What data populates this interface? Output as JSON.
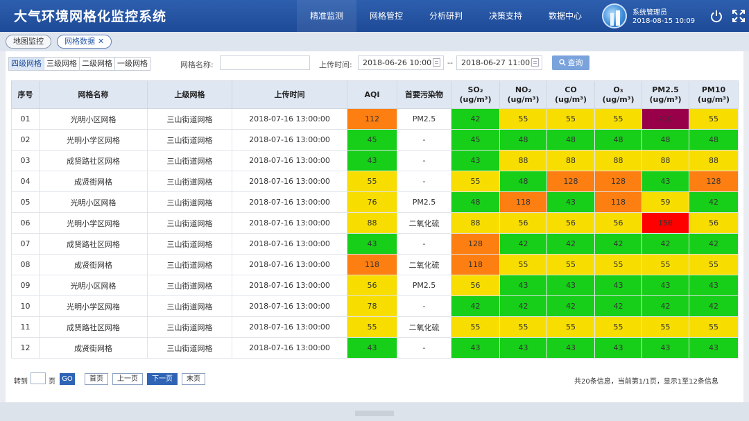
{
  "header": {
    "title": "大气环境网格化监控系统",
    "nav": [
      "精准监测",
      "网格管控",
      "分析研判",
      "决策支持",
      "数据中心"
    ],
    "user_name": "系统管理员",
    "user_time": "2018-08-15 10:09"
  },
  "tabs": [
    {
      "label": "地图监控"
    },
    {
      "label": "网格数据",
      "close": "✕"
    }
  ],
  "filters": {
    "levels": [
      "四级网格",
      "三级网格",
      "二级网格",
      "一级网格"
    ],
    "grid_name_label": "网格名称:",
    "grid_name_value": "",
    "upload_time_label": "上传时间:",
    "start_time": "2018-06-26 10:00",
    "separator": "--",
    "end_time": "2018-06-27 11:00",
    "query_label": "查询"
  },
  "table": {
    "headers": {
      "index": "序号",
      "name": "网格名称",
      "parent": "上级网格",
      "time": "上传时间",
      "aqi": "AQI",
      "primary": "首要污染物",
      "so2": "SO₂",
      "no2": "NO₂",
      "co": "CO",
      "o3": "O₃",
      "pm25": "PM2.5",
      "pm10": "PM10",
      "unit": "(ug/m³)"
    },
    "rows": [
      {
        "idx": "01",
        "name": "光明小区网格",
        "parent": "三山街道网格",
        "time": "2018-07-16 13:00:00",
        "aqi": 112,
        "primary": "PM2.5",
        "so2": 42,
        "no2": 55,
        "co": 55,
        "o3": 55,
        "pm25": 210,
        "pm10": 55
      },
      {
        "idx": "02",
        "name": "光明小学区网格",
        "parent": "三山街道网格",
        "time": "2018-07-16 13:00:00",
        "aqi": 45,
        "primary": "-",
        "so2": 45,
        "no2": 48,
        "co": 48,
        "o3": 48,
        "pm25": 48,
        "pm10": 48
      },
      {
        "idx": "03",
        "name": "成贤路社区网格",
        "parent": "三山街道网格",
        "time": "2018-07-16 13:00:00",
        "aqi": 43,
        "primary": "-",
        "so2": 43,
        "no2": 88,
        "co": 88,
        "o3": 88,
        "pm25": 88,
        "pm10": 88
      },
      {
        "idx": "04",
        "name": "成贤街网格",
        "parent": "三山街道网格",
        "time": "2018-07-16 13:00:00",
        "aqi": 55,
        "primary": "-",
        "so2": 55,
        "no2": 48,
        "co": 128,
        "o3": 128,
        "pm25": 43,
        "pm10": 128
      },
      {
        "idx": "05",
        "name": "光明小区网格",
        "parent": "三山街道网格",
        "time": "2018-07-16 13:00:00",
        "aqi": 76,
        "primary": "PM2.5",
        "so2": 48,
        "no2": 118,
        "co": 43,
        "o3": 118,
        "pm25": 59,
        "pm10": 42
      },
      {
        "idx": "06",
        "name": "光明小学区网格",
        "parent": "三山街道网格",
        "time": "2018-07-16 13:00:00",
        "aqi": 88,
        "primary": "二氧化硫",
        "so2": 88,
        "no2": 56,
        "co": 56,
        "o3": 56,
        "pm25": 156,
        "pm10": 56
      },
      {
        "idx": "07",
        "name": "成贤路社区网格",
        "parent": "三山街道网格",
        "time": "2018-07-16 13:00:00",
        "aqi": 43,
        "primary": "-",
        "so2": 128,
        "no2": 42,
        "co": 42,
        "o3": 42,
        "pm25": 42,
        "pm10": 42
      },
      {
        "idx": "08",
        "name": "成贤街网格",
        "parent": "三山街道网格",
        "time": "2018-07-16 13:00:00",
        "aqi": 118,
        "primary": "二氧化硫",
        "so2": 118,
        "no2": 55,
        "co": 55,
        "o3": 55,
        "pm25": 55,
        "pm10": 55
      },
      {
        "idx": "09",
        "name": "光明小区网格",
        "parent": "三山街道网格",
        "time": "2018-07-16 13:00:00",
        "aqi": 56,
        "primary": "PM2.5",
        "so2": 56,
        "no2": 43,
        "co": 43,
        "o3": 43,
        "pm25": 43,
        "pm10": 43
      },
      {
        "idx": "10",
        "name": "光明小学区网格",
        "parent": "三山街道网格",
        "time": "2018-07-16 13:00:00",
        "aqi": 78,
        "primary": "-",
        "so2": 42,
        "no2": 42,
        "co": 42,
        "o3": 42,
        "pm25": 42,
        "pm10": 42
      },
      {
        "idx": "11",
        "name": "成贤路社区网格",
        "parent": "三山街道网格",
        "time": "2018-07-16 13:00:00",
        "aqi": 55,
        "primary": "二氧化硫",
        "so2": 55,
        "no2": 55,
        "co": 55,
        "o3": 55,
        "pm25": 55,
        "pm10": 55
      },
      {
        "idx": "12",
        "name": "成贤街网格",
        "parent": "三山街道网格",
        "time": "2018-07-16 13:00:00",
        "aqi": 43,
        "primary": "-",
        "so2": 43,
        "no2": 43,
        "co": 43,
        "o3": 43,
        "pm25": 43,
        "pm10": 43
      }
    ]
  },
  "level_colors": {
    "green": "#17cf18",
    "yellow": "#f8de00",
    "orange": "#fd7e11",
    "red": "#fe0000",
    "purple": "#980049"
  },
  "pagination": {
    "goto_label": "转到",
    "page_unit": "页",
    "go_label": "GO",
    "first": "首页",
    "prev": "上一页",
    "next": "下一页",
    "last": "末页",
    "info": "共20条信息，当前第1/1页，显示1至12条信息"
  },
  "icons": {
    "power": "power-icon",
    "fullscreen": "fullscreen-icon",
    "search": "search-icon",
    "calendar": "calendar-icon"
  }
}
